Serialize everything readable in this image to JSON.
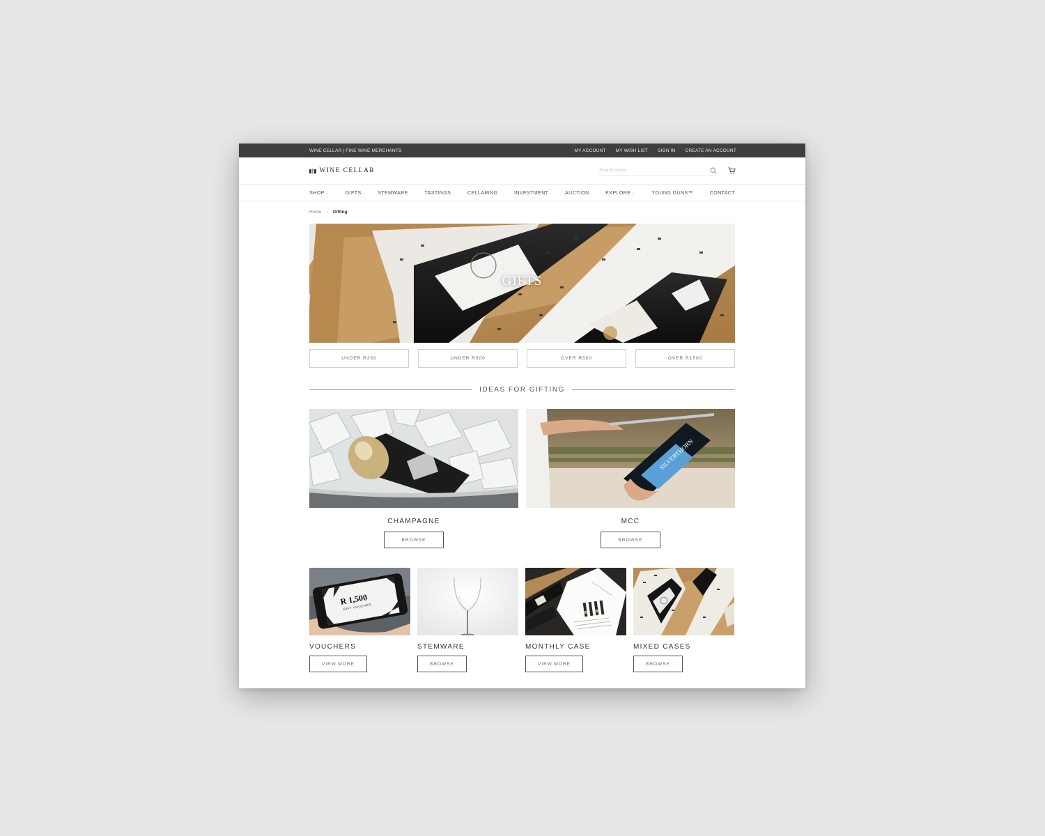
{
  "topbar": {
    "tagline": "WINE CELLAR | FINE WINE MERCHANTS",
    "links": [
      "MY ACCOUNT",
      "MY WISH LIST",
      "SIGN IN",
      "CREATE AN ACCOUNT"
    ]
  },
  "header": {
    "logo_text": "WINE CELLAR",
    "search_placeholder": "Search wines"
  },
  "nav": {
    "items": [
      "SHOP",
      "GIFTS",
      "STEMWARE",
      "TASTINGS",
      "CELLARING",
      "INVESTMENT",
      "AUCTION",
      "EXPLORE",
      "YOUNG GUNS™",
      "CONTACT"
    ]
  },
  "breadcrumb": {
    "home": "Home",
    "current": "Gifting"
  },
  "hero": {
    "title": "GIFTS"
  },
  "price_filters": [
    "UNDER R250",
    "UNDER R500",
    "OVER R500",
    "OVER R1500"
  ],
  "ideas": {
    "heading": "IDEAS FOR GIFTING",
    "featured": [
      {
        "title": "CHAMPAGNE",
        "button": "BROWSE"
      },
      {
        "title": "MCC",
        "button": "BROWSE"
      }
    ],
    "cards": [
      {
        "title": "VOUCHERS",
        "button": "VIEW MORE"
      },
      {
        "title": "STEMWARE",
        "button": "BROWSE"
      },
      {
        "title": "MONTHLY CASE",
        "button": "VIEW MORE"
      },
      {
        "title": "MIXED CASES",
        "button": "BROWSE"
      }
    ]
  },
  "voucher": {
    "amount": "R 1,500",
    "label": "GIFT VOUCHER"
  },
  "colors": {
    "topbar": "#3f3f3f",
    "background": "#e6e8e7",
    "accent_gold": "#b08a4a",
    "mcc_blue": "#4a8fc9"
  }
}
